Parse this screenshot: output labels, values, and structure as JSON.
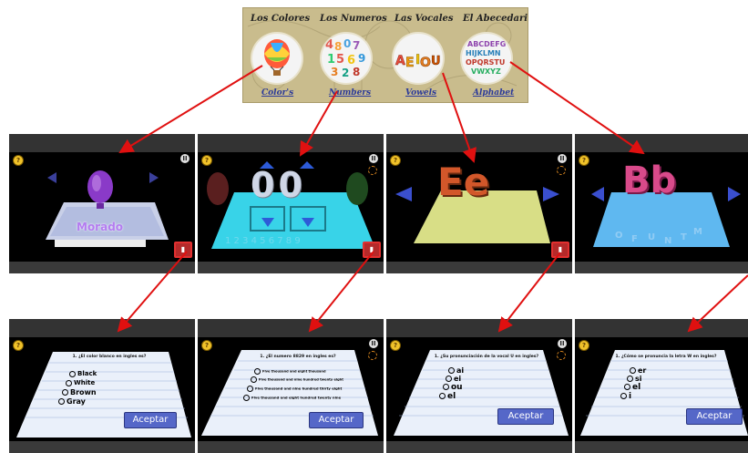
{
  "menu": {
    "items": [
      {
        "title": "Los Colores",
        "label": "Color's",
        "icon": "hot-air-balloon-icon"
      },
      {
        "title": "Los Numeros",
        "label": "Numbers",
        "icon": "numbers-icon"
      },
      {
        "title": "Las Vocales",
        "label": "Vowels",
        "icon": "vowels-icon",
        "icon_text": "AEIOU"
      },
      {
        "title": "El Abecedario",
        "label": "Alphabet",
        "icon": "alphabet-icon",
        "icon_text": "ABCDEFG HIJKLMN OPQRSTU VWXYZ"
      }
    ]
  },
  "scenes": [
    {
      "word": "Morado",
      "icons": [
        "hint-icon",
        "pause-icon",
        "target-icon",
        "book-icon"
      ]
    },
    {
      "word": "00",
      "icons": [
        "hint-icon",
        "pause-icon",
        "target-icon",
        "book-icon"
      ]
    },
    {
      "word": "Ee",
      "icons": [
        "hint-icon",
        "pause-icon",
        "target-icon",
        "book-icon"
      ]
    },
    {
      "word": "Bb",
      "icons": [
        "hint-icon",
        "pause-icon",
        "target-icon",
        "book-icon"
      ]
    }
  ],
  "quizzes": [
    {
      "question": "1. ¿El color blanco en ingles es?",
      "options": [
        "Black",
        "White",
        "Brown",
        "Gray"
      ],
      "accept": "Aceptar"
    },
    {
      "question": "1. ¿El numero 8829 en ingles es?",
      "options": [
        "Five thousand and eight thousand",
        "Five thousand and nine hundred twenty eight",
        "Five thousand and nine hundred thirty eight",
        "Five thousand and eight hundred twenty nine"
      ],
      "accept": "Aceptar"
    },
    {
      "question": "1. ¿Su pronunciación de la vocal U en ingles?",
      "options": [
        "ai",
        "ei",
        "ou",
        "el"
      ],
      "accept": "Aceptar"
    },
    {
      "question": "1. ¿Cómo se pronuncia la letra W en ingles?",
      "options": [
        "er",
        "si",
        "el",
        "i"
      ],
      "accept": "Aceptar"
    }
  ],
  "colors": {
    "arrow": "#e01010",
    "accept_button": "#5567c8",
    "menu_bg": "#c9bc8d",
    "link": "#2b3a9a"
  }
}
